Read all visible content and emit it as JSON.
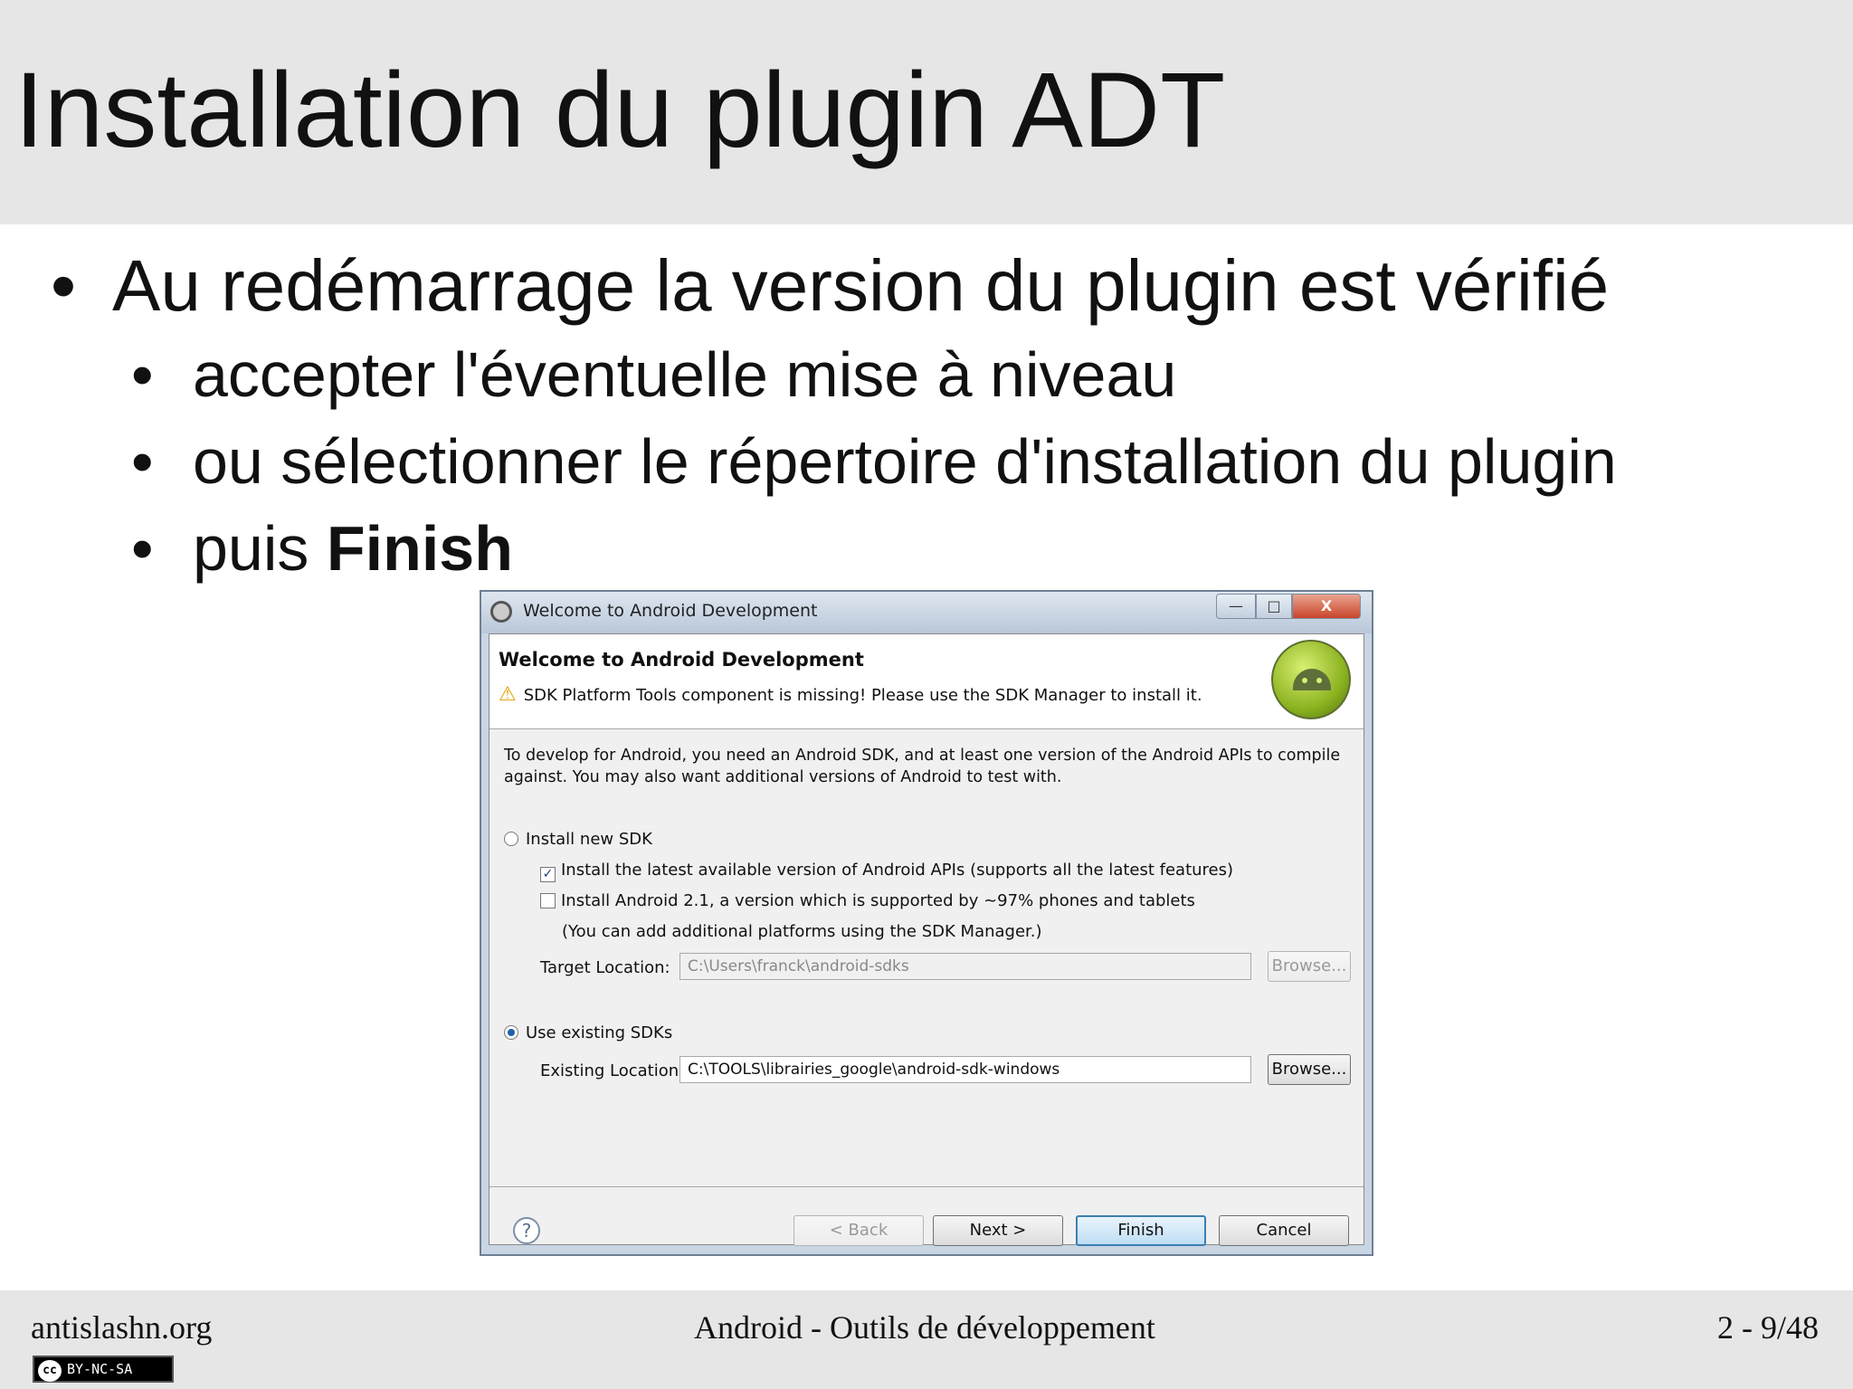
{
  "slide": {
    "title": "Installation du plugin ADT",
    "bullets": {
      "main": "Au redémarrage la version du plugin est vérifié",
      "sub1": "accepter l'éventuelle mise à niveau",
      "sub2": "ou sélectionner le répertoire d'installation du plugin",
      "sub3_prefix": "puis ",
      "sub3_bold": "Finish"
    },
    "bullet_glyph": "•"
  },
  "dialog": {
    "window_title": "Welcome to Android Development",
    "window_controls": {
      "minimize": "—",
      "maximize": "□",
      "close": "X"
    },
    "header_title": "Welcome to Android Development",
    "warning_glyph": "⚠",
    "warning_text": "SDK Platform Tools component is missing! Please use the SDK Manager to install it.",
    "intro_text": "To develop for Android, you need an Android SDK, and at least one version of the Android APIs to compile against. You may also want additional versions of Android to test with.",
    "install_new_sdk": {
      "label": "Install new SDK",
      "selected": false,
      "opt_latest": {
        "label": "Install the latest available version of Android APIs (supports all the latest features)",
        "checked": true
      },
      "opt_21": {
        "label": "Install Android 2.1, a version which is supported by ~97% phones and tablets",
        "checked": false
      },
      "note": "(You can add additional platforms using the SDK Manager.)",
      "target_label": "Target Location:",
      "target_value": "C:\\Users\\franck\\android-sdks",
      "browse_label": "Browse..."
    },
    "use_existing": {
      "label": "Use existing SDKs",
      "selected": true,
      "existing_label": "Existing Location:",
      "existing_value": "C:\\TOOLS\\librairies_google\\android-sdk-windows",
      "browse_label": "Browse..."
    },
    "check_mark": "✓",
    "help_glyph": "?",
    "buttons": {
      "back": "< Back",
      "next": "Next >",
      "finish": "Finish",
      "cancel": "Cancel"
    }
  },
  "footer": {
    "site": "antislashn.org",
    "course": "Android - Outils de développement",
    "page": "2 - 9/48",
    "license_cc": "cc",
    "license_text": "BY-NC-SA"
  },
  "colors": {
    "band": "#e6e6e6",
    "dialog_frame": "#c9d5e3",
    "default_button_border": "#3c7fb1",
    "warning": "#e0a000"
  }
}
